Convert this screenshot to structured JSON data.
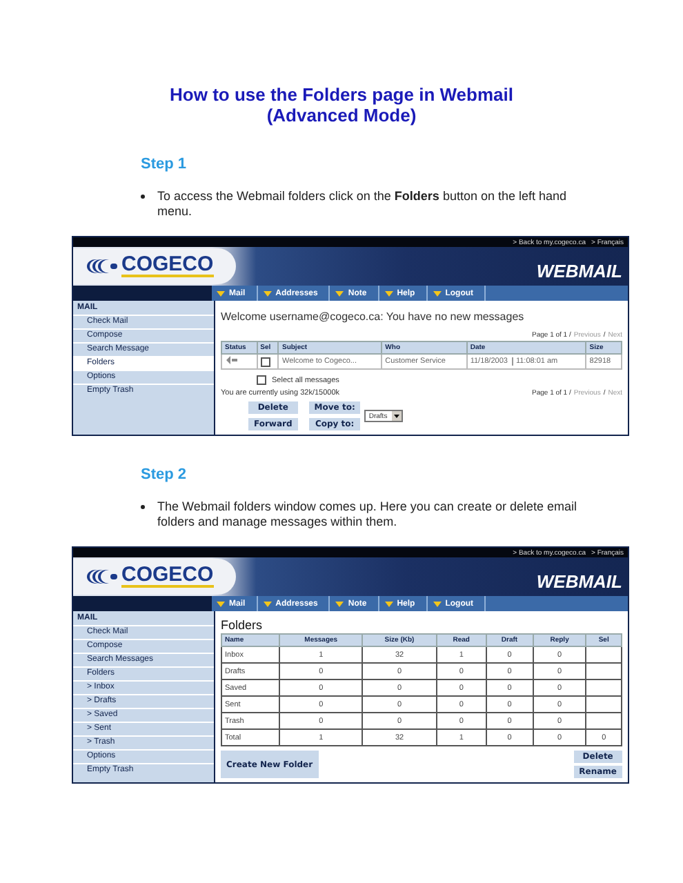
{
  "title": [
    "How to use the Folders page in Webmail",
    "(Advanced Mode)"
  ],
  "steps": [
    {
      "heading": "Step 1",
      "bullet": "To access the Webmail folders click on the **Folders** button on the left hand menu.",
      "screenshot": {
        "kind": "inbox",
        "top_links": [
          "> Back to my.cogeco.ca",
          "> Français"
        ],
        "logo": "COGECO",
        "brand": "WEBMAIL",
        "nav": [
          "Mail",
          "Addresses",
          "Note",
          "Help",
          "Logout"
        ],
        "sidebar": {
          "header": "MAIL",
          "items": [
            {
              "label": "Check Mail",
              "selected": false
            },
            {
              "label": "Compose",
              "selected": false
            },
            {
              "label": "Search Message",
              "selected": false
            },
            {
              "label": "Folders",
              "selected": true
            },
            {
              "label": "Options",
              "selected": false
            },
            {
              "label": "Empty Trash",
              "selected": false
            }
          ]
        },
        "welcome": "Welcome username@cogeco.ca: You have no new messages",
        "pager": [
          "Page 1 of 1 /",
          "Previous",
          "/",
          "Next"
        ],
        "columns": [
          "Status",
          "Sel",
          "Subject",
          "Who",
          "Date",
          "Size"
        ],
        "rows": [
          {
            "checked": false,
            "subject": "Welcome to Cogeco...",
            "who": "Customer Service",
            "date": "11/18/2003",
            "time": "11:08:01 am",
            "size": "82918"
          }
        ],
        "select_all": {
          "label": "Select all messages",
          "checked": false
        },
        "usage": "You are currently using 32k/15000k",
        "pager_bottom": [
          "Page 1 of 1 /",
          "Previous",
          "/",
          "Next"
        ],
        "buttons": [
          "Delete",
          "Move to:",
          "Forward",
          "Copy to:"
        ],
        "folder_select": "Drafts"
      }
    },
    {
      "heading": "Step 2",
      "bullet": "The Webmail folders window comes up. Here you can create or delete email folders and manage messages within them.",
      "screenshot": {
        "kind": "folders",
        "top_links": [
          "> Back to my.cogeco.ca",
          "> Français"
        ],
        "logo": "COGECO",
        "brand": "WEBMAIL",
        "nav": [
          "Mail",
          "Addresses",
          "Note",
          "Help",
          "Logout"
        ],
        "sidebar": {
          "header": "MAIL",
          "items": [
            {
              "label": "Check Mail",
              "selected": false
            },
            {
              "label": "Compose",
              "selected": false
            },
            {
              "label": "Search Messages",
              "selected": false
            },
            {
              "label": "Folders",
              "selected": false
            },
            {
              "label": "> Inbox",
              "selected": false
            },
            {
              "label": "> Drafts",
              "selected": false
            },
            {
              "label": "> Saved",
              "selected": false
            },
            {
              "label": "> Sent",
              "selected": false
            },
            {
              "label": "> Trash",
              "selected": false
            },
            {
              "label": "Options",
              "selected": false
            },
            {
              "label": "Empty Trash",
              "selected": false
            }
          ]
        },
        "heading": "Folders",
        "columns": [
          "Name",
          "Messages",
          "Size (Kb)",
          "Read",
          "Draft",
          "Reply",
          "Sel"
        ],
        "rows": [
          [
            "Inbox",
            "1",
            "32",
            "1",
            "0",
            "0"
          ],
          [
            "Drafts",
            "0",
            "0",
            "0",
            "0",
            "0"
          ],
          [
            "Saved",
            "0",
            "0",
            "0",
            "0",
            "0"
          ],
          [
            "Sent",
            "0",
            "0",
            "0",
            "0",
            "0"
          ],
          [
            "Trash",
            "0",
            "0",
            "0",
            "0",
            "0"
          ],
          [
            "Total",
            "1",
            "32",
            "1",
            "0",
            "0",
            "0"
          ]
        ],
        "buttons_left": [
          "Create New Folder"
        ],
        "buttons_right": [
          "Delete",
          "Rename"
        ]
      }
    }
  ]
}
